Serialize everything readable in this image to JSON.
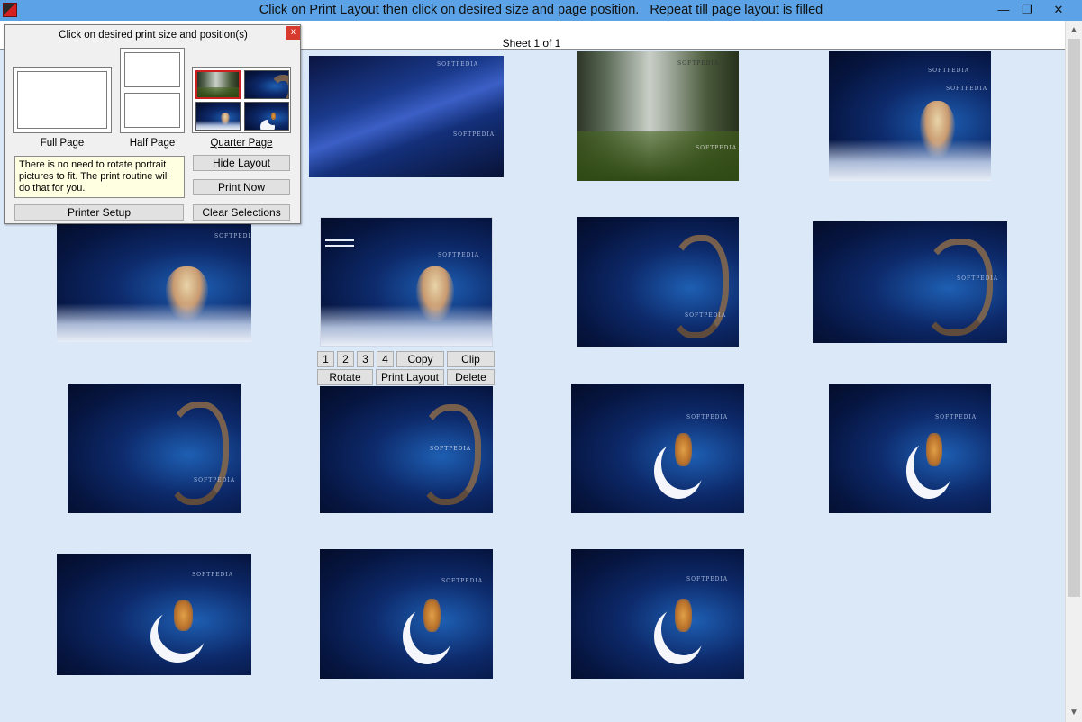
{
  "window": {
    "title": "Click on Print Layout then click on desired size and page position.   Repeat till page layout is filled",
    "minimize_glyph": "—",
    "restore_glyph": "❐",
    "close_glyph": "✕",
    "icon": "app-icon"
  },
  "sheet": {
    "label": "Sheet 1 of 1"
  },
  "layout_panel": {
    "title": "Click on desired print size and position(s)",
    "close_glyph": "x",
    "full_page_label": "Full Page",
    "half_page_label": "Half Page",
    "quarter_page_label": "Quarter Page",
    "note": "There is no need to rotate portrait pictures to fit. The print routine will do that for you.",
    "hide_layout_label": "Hide Layout",
    "print_now_label": "Print Now",
    "printer_setup_label": "Printer Setup",
    "clear_selections_label": "Clear Selections"
  },
  "image_controls": {
    "btn1": "1",
    "btn2": "2",
    "btn3": "3",
    "btn4": "4",
    "copy": "Copy",
    "clip": "Clip",
    "rotate": "Rotate",
    "print_layout": "Print Layout",
    "delete": "Delete"
  },
  "watermark": "SOFTPEDIA",
  "scrollbar": {
    "up_glyph": "▲",
    "down_glyph": "▼"
  },
  "colors": {
    "title_bar": "#5ba3e6",
    "background": "#dbe8f8",
    "selected_border": "#cc2020"
  }
}
